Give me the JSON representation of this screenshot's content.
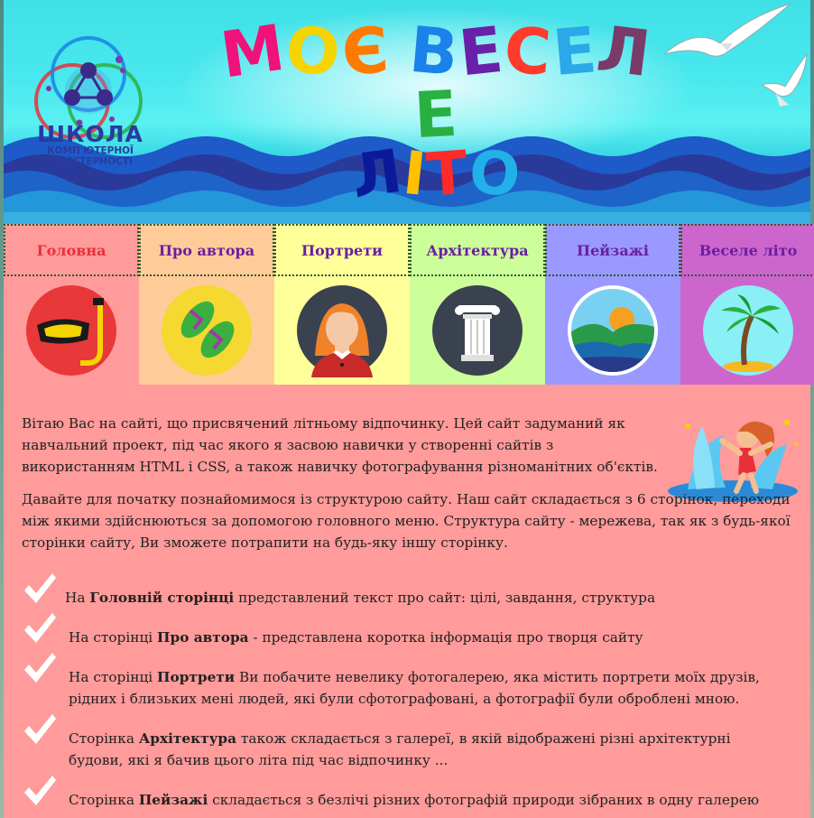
{
  "header": {
    "logo": {
      "line1": "ШКОЛА",
      "line2": "КОМП'ЮТЕРНОЇ",
      "line3": "МАЙСТЕРНОСТІ"
    },
    "title_line1": "МОЄ ВЕСЕЛЕ",
    "title_line2": "ЛІТО",
    "title_colors_line1": [
      "#f0127a",
      "#f5d400",
      "#ff7a00",
      "#1a82e8",
      "#6a1fa8",
      "#ff3a2a",
      "#2aa8e8",
      "#7a3a6a",
      "#2ab040",
      "#f0127a"
    ],
    "title_colors_line2": [
      "#0a1a9a",
      "#ffc000",
      "#ff2a2a",
      "#22b0e8"
    ]
  },
  "nav": {
    "items": [
      {
        "label": "Головна",
        "bg": "#ff9b9a",
        "color": "#e8303a",
        "icon": "diving-mask-icon"
      },
      {
        "label": "Про автора",
        "bg": "#ffcc99",
        "color": "#6a1fa0",
        "icon": "flip-flops-icon"
      },
      {
        "label": "Портрети",
        "bg": "#ffff99",
        "color": "#6a1fa0",
        "icon": "woman-portrait-icon"
      },
      {
        "label": "Архітектура",
        "bg": "#ccff99",
        "color": "#6a1fa0",
        "icon": "column-icon"
      },
      {
        "label": "Пейзажі",
        "bg": "#9999ff",
        "color": "#6a1fa0",
        "icon": "landscape-icon"
      },
      {
        "label": "Веселе літо",
        "bg": "#cc66cc",
        "color": "#6a1fa0",
        "icon": "palm-tree-icon"
      }
    ]
  },
  "main": {
    "intro1": "Вітаю Вас на сайті, що присвячений літньому відпочинку. Цей сайт задуманий як навчальний проект, під час якого я засвою навички у створенні сайтів з використанням HTML і CSS, а також навичку фотографування різноманітних об'єктів.",
    "intro2": "Давайте для початку познайомимося із структурою сайту. Наш сайт складається з 6 сторінок, переходи між якими здійснюються за допомогою головного меню. Структура сайту - мережева, так як з будь-якої сторінки сайту, Ви зможете потрапити на будь-яку іншу сторінку.",
    "items": [
      {
        "pre": "На ",
        "bold": "Головній сторінці",
        "post": " представлений текст про сайт: цілі, завдання, структура"
      },
      {
        "pre": "На сторінці ",
        "bold": "Про автора",
        "post": " - представлена коротка інформація про творця сайту"
      },
      {
        "pre": "На сторінці ",
        "bold": "Портрети",
        "post": " Ви побачите невелику фотогалерею, яка містить портрети моїх друзів, рідних і близьких мені людей, які були сфотографовані, а фотографії були оброблені мною."
      },
      {
        "pre": "Сторінка ",
        "bold": "Архітектура",
        "post": " також складається з галереї, в якій відображені різні архітектурні будови, які я бачив цього літа під час відпочинку ..."
      },
      {
        "pre": "Сторінка ",
        "bold": "Пейзажі",
        "post": " складається з безлічі різних фотографій природи зібраних в одну галерею"
      }
    ]
  }
}
